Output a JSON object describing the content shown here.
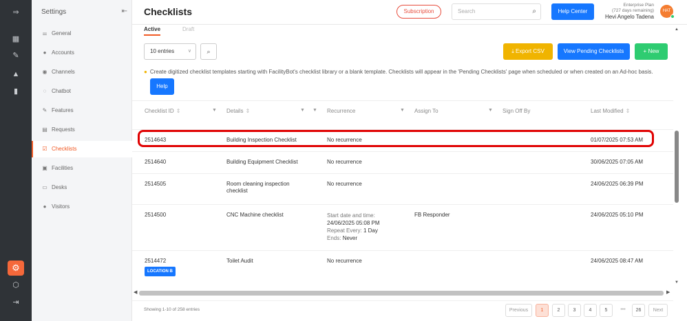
{
  "rail": {
    "icons": [
      "menu-expand-icon",
      "dashboard-icon",
      "pin-icon",
      "analytics-icon",
      "report-icon",
      "settings-icon",
      "cube-icon",
      "logout-icon"
    ]
  },
  "sidebar": {
    "title": "Settings",
    "items": [
      {
        "label": "General",
        "icon": "sliders-icon"
      },
      {
        "label": "Accounts",
        "icon": "users-icon"
      },
      {
        "label": "Channels",
        "icon": "chat-icon"
      },
      {
        "label": "Chatbot",
        "icon": "chatbot-icon"
      },
      {
        "label": "Features",
        "icon": "pin-icon"
      },
      {
        "label": "Requests",
        "icon": "inbox-icon"
      },
      {
        "label": "Checklists",
        "icon": "checklist-icon",
        "active": true
      },
      {
        "label": "Facilities",
        "icon": "calendar-icon"
      },
      {
        "label": "Desks",
        "icon": "desk-icon"
      },
      {
        "label": "Visitors",
        "icon": "visitor-icon"
      }
    ]
  },
  "header": {
    "title": "Checklists",
    "subscription_label": "Subscription",
    "search_placeholder": "Search",
    "help_center_label": "Help Center",
    "plan_name": "Enterprise Plan",
    "plan_days": "(727 days remaining)",
    "user_name": "Hevi Angelo Tadena",
    "avatar_initials": "HAT"
  },
  "tabs": [
    {
      "label": "Active",
      "active": true
    },
    {
      "label": "Draft",
      "active": false
    }
  ],
  "toolbar": {
    "entries_value": "10 entries",
    "export_csv_label": "Export CSV",
    "view_pending_label": "View Pending Checklists",
    "new_label": "New"
  },
  "info": {
    "text": "Create digitized checklist templates starting with FacilityBot's checklist library or a blank template. Checklists will appear in the 'Pending Checklists' page when scheduled or when created on an Ad-hoc basis.",
    "help_label": "Help"
  },
  "table": {
    "columns": [
      "Checklist ID",
      "Details",
      "Recurrence",
      "Assign To",
      "Sign Off By",
      "Last Modified"
    ],
    "rows": [
      {
        "id": "2514643",
        "details": "Building Inspection Checklist",
        "recurrence": "No recurrence",
        "assign_to": "",
        "sign_off_by": "",
        "last_modified": "01/07/2025 07:53 AM"
      },
      {
        "id": "2514640",
        "details": "Building Equipment Checklist",
        "recurrence": "No recurrence",
        "assign_to": "",
        "sign_off_by": "",
        "last_modified": "30/06/2025 07:05 AM"
      },
      {
        "id": "2514505",
        "details": "Room cleaning inspection checklist",
        "recurrence": "No recurrence",
        "assign_to": "",
        "sign_off_by": "",
        "last_modified": "24/06/2025 06:39 PM"
      },
      {
        "id": "2514500",
        "details": "CNC Machine checklist",
        "recurrence_start_label": "Start date and time:",
        "recurrence_start_value": "24/06/2025 05:08 PM",
        "recurrence_repeat_label": "Repeat Every:",
        "recurrence_repeat_value": "1 Day",
        "recurrence_ends_label": "Ends:",
        "recurrence_ends_value": "Never",
        "assign_to": "FB Responder",
        "sign_off_by": "",
        "last_modified": "24/06/2025 05:10 PM"
      },
      {
        "id": "2514472",
        "details": "Toilet Audit",
        "recurrence": "No recurrence",
        "badge": "LOCATION B",
        "assign_to": "",
        "sign_off_by": "",
        "last_modified": "24/06/2025 08:47 AM"
      }
    ]
  },
  "footer": {
    "showing": "Showing 1-10 of 258 entries",
    "previous": "Previous",
    "pages": [
      "1",
      "2",
      "3",
      "4",
      "5"
    ],
    "ellipsis": "•••",
    "last_page": "26",
    "next": "Next",
    "current_page": 1
  },
  "colors": {
    "accent": "#f15a24",
    "primary": "#1677ff",
    "warning": "#f0b400",
    "success": "#2ecc71",
    "highlight": "#e00000",
    "rail": "#2f3337"
  }
}
